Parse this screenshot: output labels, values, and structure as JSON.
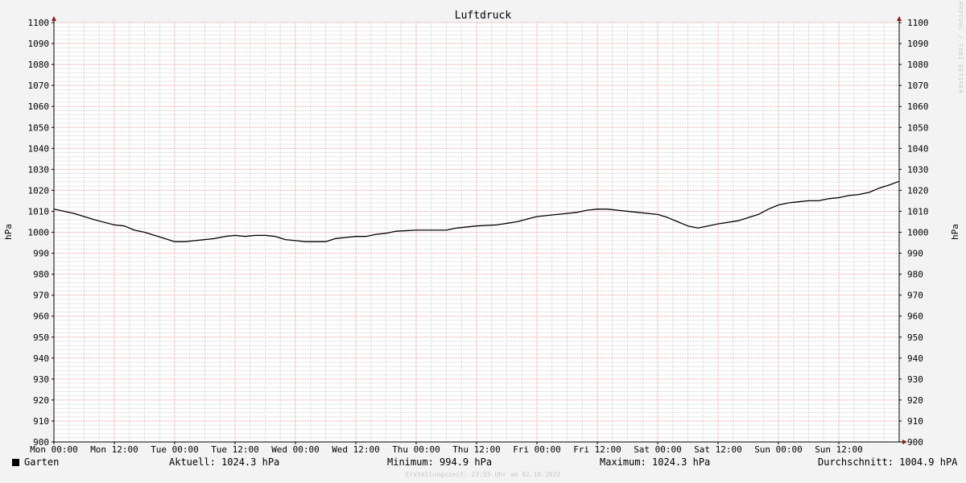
{
  "chart_data": {
    "type": "line",
    "title": "Luftdruck",
    "ylabel": "hPa",
    "ylim": [
      900,
      1100
    ],
    "ytick_step": 10,
    "xlim": [
      "Mon 00:00",
      "Mon 00:00 (+7d)"
    ],
    "x_tick_labels": [
      "Mon 00:00",
      "Mon 12:00",
      "Tue 00:00",
      "Tue 12:00",
      "Wed 00:00",
      "Wed 12:00",
      "Thu 00:00",
      "Thu 12:00",
      "Fri 00:00",
      "Fri 12:00",
      "Sat 00:00",
      "Sat 12:00",
      "Sun 00:00",
      "Sun 12:00"
    ],
    "x_tick_hours": [
      0,
      12,
      24,
      36,
      48,
      60,
      72,
      84,
      96,
      108,
      120,
      132,
      144,
      156
    ],
    "grid": true,
    "series": [
      {
        "name": "Garten",
        "color": "#000000",
        "points": [
          {
            "x_hours": 0,
            "y": 1011
          },
          {
            "x_hours": 4,
            "y": 1009
          },
          {
            "x_hours": 8,
            "y": 1006
          },
          {
            "x_hours": 12,
            "y": 1003.5
          },
          {
            "x_hours": 14,
            "y": 1003
          },
          {
            "x_hours": 16,
            "y": 1001
          },
          {
            "x_hours": 18,
            "y": 1000
          },
          {
            "x_hours": 20,
            "y": 998.5
          },
          {
            "x_hours": 22,
            "y": 997
          },
          {
            "x_hours": 24,
            "y": 995.5
          },
          {
            "x_hours": 26,
            "y": 995.5
          },
          {
            "x_hours": 28,
            "y": 996
          },
          {
            "x_hours": 32,
            "y": 997
          },
          {
            "x_hours": 34,
            "y": 998
          },
          {
            "x_hours": 36,
            "y": 998.5
          },
          {
            "x_hours": 38,
            "y": 998
          },
          {
            "x_hours": 40,
            "y": 998.5
          },
          {
            "x_hours": 42,
            "y": 998.5
          },
          {
            "x_hours": 44,
            "y": 998
          },
          {
            "x_hours": 46,
            "y": 996.5
          },
          {
            "x_hours": 48,
            "y": 996
          },
          {
            "x_hours": 50,
            "y": 995.5
          },
          {
            "x_hours": 54,
            "y": 995.5
          },
          {
            "x_hours": 56,
            "y": 997
          },
          {
            "x_hours": 58,
            "y": 997.5
          },
          {
            "x_hours": 60,
            "y": 998
          },
          {
            "x_hours": 62,
            "y": 998
          },
          {
            "x_hours": 64,
            "y": 999
          },
          {
            "x_hours": 66,
            "y": 999.5
          },
          {
            "x_hours": 68,
            "y": 1000.5
          },
          {
            "x_hours": 72,
            "y": 1001
          },
          {
            "x_hours": 78,
            "y": 1001
          },
          {
            "x_hours": 80,
            "y": 1002
          },
          {
            "x_hours": 84,
            "y": 1003
          },
          {
            "x_hours": 88,
            "y": 1003.5
          },
          {
            "x_hours": 92,
            "y": 1005
          },
          {
            "x_hours": 96,
            "y": 1007.5
          },
          {
            "x_hours": 100,
            "y": 1008.5
          },
          {
            "x_hours": 104,
            "y": 1009.5
          },
          {
            "x_hours": 106,
            "y": 1010.5
          },
          {
            "x_hours": 108,
            "y": 1011
          },
          {
            "x_hours": 110,
            "y": 1011
          },
          {
            "x_hours": 112,
            "y": 1010.5
          },
          {
            "x_hours": 116,
            "y": 1009.5
          },
          {
            "x_hours": 120,
            "y": 1008.5
          },
          {
            "x_hours": 122,
            "y": 1007
          },
          {
            "x_hours": 124,
            "y": 1005
          },
          {
            "x_hours": 126,
            "y": 1003
          },
          {
            "x_hours": 128,
            "y": 1002
          },
          {
            "x_hours": 130,
            "y": 1003
          },
          {
            "x_hours": 132,
            "y": 1004
          },
          {
            "x_hours": 136,
            "y": 1005.5
          },
          {
            "x_hours": 140,
            "y": 1008.5
          },
          {
            "x_hours": 142,
            "y": 1011
          },
          {
            "x_hours": 144,
            "y": 1013
          },
          {
            "x_hours": 146,
            "y": 1014
          },
          {
            "x_hours": 148,
            "y": 1014.5
          },
          {
            "x_hours": 150,
            "y": 1015
          },
          {
            "x_hours": 152,
            "y": 1015
          },
          {
            "x_hours": 154,
            "y": 1016
          },
          {
            "x_hours": 156,
            "y": 1016.5
          },
          {
            "x_hours": 158,
            "y": 1017.5
          },
          {
            "x_hours": 160,
            "y": 1018
          },
          {
            "x_hours": 162,
            "y": 1019
          },
          {
            "x_hours": 164,
            "y": 1021
          },
          {
            "x_hours": 166,
            "y": 1022.5
          },
          {
            "x_hours": 168,
            "y": 1024.3
          }
        ]
      }
    ]
  },
  "legend": {
    "series_name": "Garten",
    "current": "Aktuell: 1024.3 hPa",
    "minimum": "Minimum: 994.9 hPa",
    "maximum": "Maximum: 1024.3 hPa",
    "average": "Durchschnitt: 1004.9 hPA"
  },
  "footer": "Erstellungszeit: 23:55 Uhr am 02.10.2022",
  "watermark": "RRDTOOL / TOBI OETIKER",
  "colors": {
    "background": "#f3f3f3",
    "plot_background": "#ffffff",
    "major_grid": "#e89a9a",
    "minor_grid": "#d0d0d0",
    "axis": "#000000",
    "arrow": "#8b1a1a"
  }
}
